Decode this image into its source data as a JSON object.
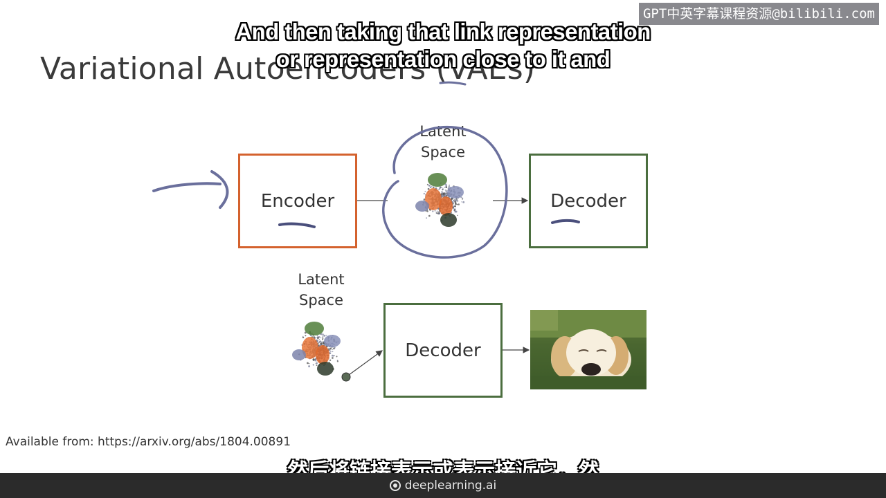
{
  "slide": {
    "title": "Variational Autoencoders (VAEs)",
    "encoder_label": "Encoder",
    "decoder_label": "Decoder",
    "latent_label_line1": "Latent",
    "latent_label_line2": "Space",
    "citation": "Available from: https://arxiv.org/abs/1804.00891"
  },
  "subtitles": {
    "english_line1": "And then taking that link representation",
    "english_line2": "or representation close to it and",
    "chinese": "然后将链接表示或表示接近它，然"
  },
  "watermark": "GPT中英字幕课程资源@bilibili.com",
  "footer": {
    "brand": "deeplearning.ai",
    "icon": "deeplearning-logo-icon"
  },
  "colors": {
    "encoder_border": "#d4622e",
    "decoder_border": "#4b6e3f",
    "annotation_ink": "#6a6f9c",
    "footer_bg": "#2b2b2b"
  }
}
